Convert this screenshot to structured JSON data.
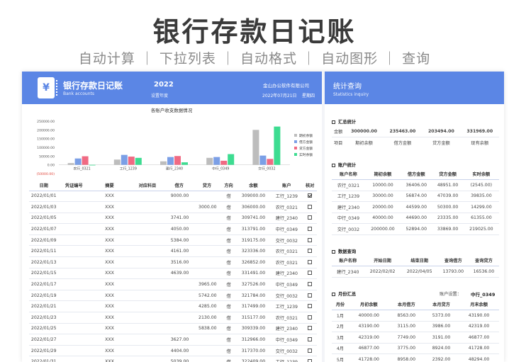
{
  "hero": {
    "title": "银行存款日记账",
    "subtitle": "自动计算 ｜ 下拉列表 ｜ 自动格式 ｜ 自动图形 ｜ 查询"
  },
  "left_header": {
    "icon": "¥",
    "title": "银行存款日记账",
    "subtitle_en": "Bank accounts",
    "year": "2022",
    "year_label": "设置年度",
    "company": "金山办公软件有限公司",
    "date": "2022年07月21日",
    "weekday": "星期四"
  },
  "right_header": {
    "title": "统计查询",
    "subtitle_en": "Statistics  inquiry"
  },
  "chart_data": {
    "type": "bar",
    "title": "各账户收支数据情况",
    "categories": [
      "农行_0321",
      "工行_1239",
      "建行_2340",
      "中行_0349",
      "交行_0032"
    ],
    "series": [
      {
        "name": "期初余额",
        "color": "#bdbdbd",
        "values": [
          10000,
          30000,
          20000,
          40000,
          200000
        ]
      },
      {
        "name": "借方金额",
        "color": "#7b9fe6",
        "values": [
          36406,
          56874,
          44599,
          44690,
          52894
        ]
      },
      {
        "name": "贷方金额",
        "color": "#f06a83",
        "values": [
          48951,
          47039,
          50300,
          23335,
          33869
        ]
      },
      {
        "name": "实时余额",
        "color": "#3ddc91",
        "values": [
          -2545,
          39835,
          14299,
          61355,
          219025
        ]
      }
    ],
    "yticks": [
      "250000.00",
      "200000.00",
      "150000.00",
      "100000.00",
      "50000.00",
      "0.00",
      "(50000.00)"
    ],
    "ylim": [
      -50000,
      250000
    ],
    "legend": "right"
  },
  "journal": {
    "columns": [
      "日期",
      "凭证编号",
      "摘要",
      "对应科目",
      "借方",
      "贷方",
      "方向",
      "余额",
      "账户",
      "核对"
    ],
    "rows": [
      {
        "date": "2022/01/01",
        "voucher": "",
        "desc": "XXX",
        "subject": "",
        "debit": "9000.00",
        "credit": "",
        "dir": "借",
        "balance": "309000.00",
        "account": "工行_1239",
        "check": "checked"
      },
      {
        "date": "2022/01/03",
        "voucher": "",
        "desc": "XXX",
        "subject": "",
        "debit": "",
        "credit": "3000.00",
        "dir": "借",
        "balance": "306000.00",
        "account": "农行_0321",
        "check": ""
      },
      {
        "date": "2022/01/05",
        "voucher": "",
        "desc": "XXX",
        "subject": "",
        "debit": "3741.00",
        "credit": "",
        "dir": "借",
        "balance": "309741.00",
        "account": "建行_2340",
        "check": ""
      },
      {
        "date": "2022/01/07",
        "voucher": "",
        "desc": "XXX",
        "subject": "",
        "debit": "4050.00",
        "credit": "",
        "dir": "借",
        "balance": "313791.00",
        "account": "中行_0349",
        "check": ""
      },
      {
        "date": "2022/01/09",
        "voucher": "",
        "desc": "XXX",
        "subject": "",
        "debit": "5384.00",
        "credit": "",
        "dir": "借",
        "balance": "319175.00",
        "account": "交行_0032",
        "check": ""
      },
      {
        "date": "2022/01/11",
        "voucher": "",
        "desc": "XXX",
        "subject": "",
        "debit": "4161.00",
        "credit": "",
        "dir": "借",
        "balance": "323336.00",
        "account": "农行_0321",
        "check": ""
      },
      {
        "date": "2022/01/13",
        "voucher": "",
        "desc": "XXX",
        "subject": "",
        "debit": "3516.00",
        "credit": "",
        "dir": "借",
        "balance": "326852.00",
        "account": "农行_0321",
        "check": ""
      },
      {
        "date": "2022/01/15",
        "voucher": "",
        "desc": "XXX",
        "subject": "",
        "debit": "4639.00",
        "credit": "",
        "dir": "借",
        "balance": "331491.00",
        "account": "建行_2340",
        "check": ""
      },
      {
        "date": "2022/01/17",
        "voucher": "",
        "desc": "XXX",
        "subject": "",
        "debit": "",
        "credit": "3965.00",
        "dir": "借",
        "balance": "327526.00",
        "account": "中行_0349",
        "check": ""
      },
      {
        "date": "2022/01/19",
        "voucher": "",
        "desc": "XXX",
        "subject": "",
        "debit": "",
        "credit": "5742.00",
        "dir": "借",
        "balance": "321784.00",
        "account": "交行_0032",
        "check": ""
      },
      {
        "date": "2022/01/21",
        "voucher": "",
        "desc": "XXX",
        "subject": "",
        "debit": "",
        "credit": "4285.00",
        "dir": "借",
        "balance": "317499.00",
        "account": "工行_1239",
        "check": ""
      },
      {
        "date": "2022/01/23",
        "voucher": "",
        "desc": "XXX",
        "subject": "",
        "debit": "",
        "credit": "2130.00",
        "dir": "借",
        "balance": "315177.00",
        "account": "农行_0321",
        "check": ""
      },
      {
        "date": "2022/01/25",
        "voucher": "",
        "desc": "XXX",
        "subject": "",
        "debit": "",
        "credit": "5838.00",
        "dir": "借",
        "balance": "309339.00",
        "account": "建行_2340",
        "check": ""
      },
      {
        "date": "2022/01/27",
        "voucher": "",
        "desc": "XXX",
        "subject": "",
        "debit": "3627.00",
        "credit": "",
        "dir": "借",
        "balance": "312966.00",
        "account": "中行_0349",
        "check": ""
      },
      {
        "date": "2022/01/29",
        "voucher": "",
        "desc": "XXX",
        "subject": "",
        "debit": "4404.00",
        "credit": "",
        "dir": "借",
        "balance": "317370.00",
        "account": "交行_0032",
        "check": ""
      },
      {
        "date": "2022/01/31",
        "voucher": "",
        "desc": "XXX",
        "subject": "",
        "debit": "5039.00",
        "credit": "",
        "dir": "借",
        "balance": "322409.00",
        "account": "工行_1239",
        "check": ""
      }
    ]
  },
  "summary": {
    "section": "汇总统计",
    "label_amount": "金额",
    "label_item": "项目",
    "values": [
      {
        "value": "300000.00",
        "label": "期初余额",
        "style": "bold"
      },
      {
        "value": "235463.00",
        "label": "借方金额",
        "style": "blue"
      },
      {
        "value": "203494.00",
        "label": "贷方金额",
        "style": "red"
      },
      {
        "value": "331969.00",
        "label": "现有余额",
        "style": "green"
      }
    ]
  },
  "accounts": {
    "section": "账户统计",
    "columns": [
      "账户名称",
      "期初余额",
      "借方金额",
      "贷方金额",
      "实时余额"
    ],
    "rows": [
      [
        "农行_0321",
        "10000.00",
        "36406.00",
        "48951.00",
        "(2545.00)"
      ],
      [
        "工行_1239",
        "30000.00",
        "56874.00",
        "47039.00",
        "39835.00"
      ],
      [
        "建行_2340",
        "20000.00",
        "44599.00",
        "50300.00",
        "14299.00"
      ],
      [
        "中行_0349",
        "40000.00",
        "44690.00",
        "23335.00",
        "61355.00"
      ],
      [
        "交行_0032",
        "200000.00",
        "52894.00",
        "33869.00",
        "219025.00"
      ]
    ]
  },
  "query": {
    "section": "数据查询",
    "columns": [
      "账户名称",
      "开始日期",
      "结束日期",
      "查询借方",
      "查询贷方"
    ],
    "row": [
      "建行_2340",
      "2022/02/02",
      "2022/04/05",
      "13793.00",
      "16536.00"
    ]
  },
  "monthly": {
    "section": "月份汇总",
    "account_label": "账户设置：",
    "account_value": "中行_0349",
    "columns": [
      "月份",
      "月初余额",
      "本月借方",
      "本月贷方",
      "月末余额"
    ],
    "rows": [
      [
        "1月",
        "40000.00",
        "8563.00",
        "5373.00",
        "43190.00"
      ],
      [
        "2月",
        "43190.00",
        "3115.00",
        "3986.00",
        "42319.00"
      ],
      [
        "3月",
        "42319.00",
        "7749.00",
        "3191.00",
        "46877.00"
      ],
      [
        "4月",
        "46877.00",
        "3775.00",
        "8924.00",
        "41728.00"
      ],
      [
        "5月",
        "41728.00",
        "8958.00",
        "2392.00",
        "48294.00"
      ]
    ]
  }
}
